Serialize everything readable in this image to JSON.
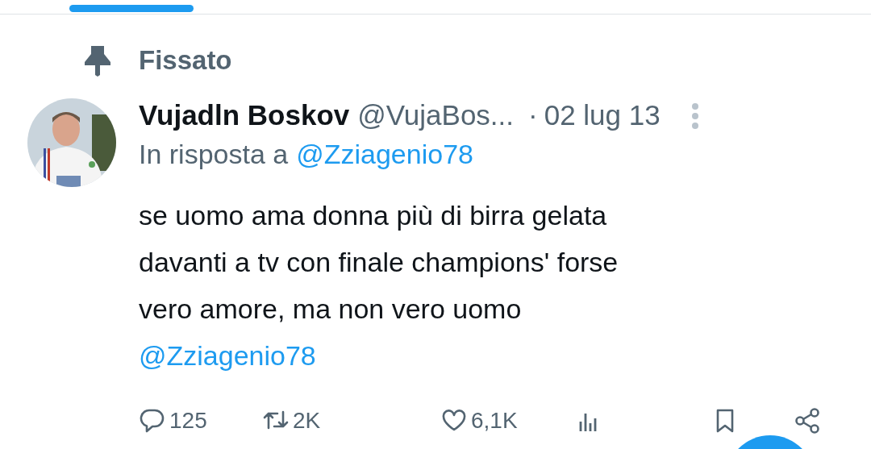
{
  "tab_indicator": {
    "selected": true
  },
  "pinned_label": "Fissato",
  "tweet": {
    "author_name": "Vujadln Boskov",
    "handle": "@VujaBos...",
    "separator": "·",
    "date": "02 lug 13",
    "reply_prefix": "In risposta a",
    "reply_to": "@Zziagenio78",
    "lines": [
      "se uomo ama donna più di birra gelata",
      "davanti a tv con finale champions' forse",
      "vero amore, ma non vero uomo"
    ],
    "mention": "@Zziagenio78",
    "actions": [
      {
        "kind": "reply",
        "count": "125"
      },
      {
        "kind": "retweet",
        "count": "2K"
      },
      {
        "kind": "like",
        "count": "6,1K"
      },
      {
        "kind": "views"
      },
      {
        "kind": "bookmark"
      },
      {
        "kind": "share"
      }
    ]
  }
}
